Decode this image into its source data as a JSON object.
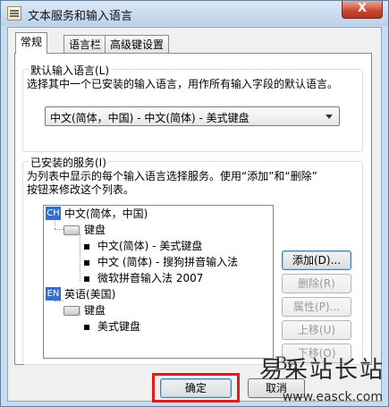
{
  "window": {
    "title": "文本服务和输入语言",
    "close_glyph": "X"
  },
  "tabs": [
    {
      "label": "常规",
      "active": true
    },
    {
      "label": "语言栏",
      "active": false
    },
    {
      "label": "高级键设置",
      "active": false
    }
  ],
  "default_language": {
    "group_label": "默认输入语言(L)",
    "description": "选择其中一个已安装的输入语言，用作所有输入字段的默认语言。",
    "selected": "中文(简体，中国) - 中文(简体) - 美式键盘"
  },
  "installed_services": {
    "group_label": "已安装的服务(I)",
    "description_line1": "为列表中显示的每个输入语言选择服务。使用“添加”和“删除”",
    "description_line2": "按钮来修改这个列表。",
    "tree": {
      "lang1": {
        "badge": "CH",
        "label": "中文(简体，中国)"
      },
      "lang1_keyboard": "键盘",
      "lang1_items": [
        "中文(简体) - 美式键盘",
        "中文 (简体) - 搜狗拼音输入法",
        "微软拼音输入法 2007"
      ],
      "lang2": {
        "badge": "EN",
        "label": "英语(美国)"
      },
      "lang2_keyboard": "键盘",
      "lang2_items": [
        "美式键盘"
      ]
    },
    "buttons": {
      "add": "添加(D)...",
      "remove": "删除(R)",
      "properties": "属性(P)...",
      "move_up": "上移(U)",
      "move_down": "下移(O)"
    }
  },
  "footer": {
    "ok": "确定",
    "cancel": "取消"
  },
  "watermark": {
    "text": "易采站长站",
    "url": "www.easck.com",
    "partial_text": "Ba"
  },
  "colors": {
    "highlight": "#e01b1b",
    "badge": "#2f6fd1"
  }
}
